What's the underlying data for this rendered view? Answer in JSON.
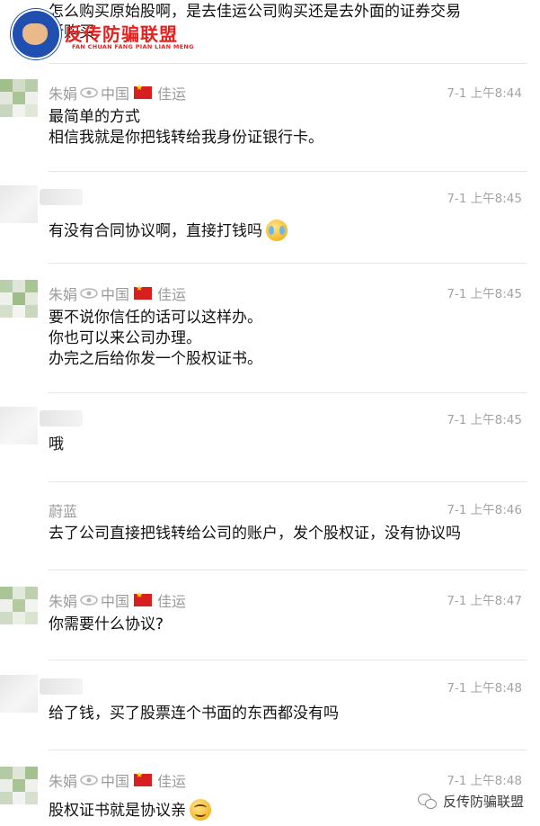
{
  "watermark_top": {
    "cn": "反传防骗联盟",
    "en": "FAN CHUAN FANG PIAN LIAN MENG"
  },
  "watermark_bottom": {
    "icon": "wechat-icon",
    "label": "反传防骗联盟"
  },
  "messages": [
    {
      "kind": "partial",
      "text": "怎么购买原始股啊，是去佳运公司购买还是去外面的证券交易\n所购买"
    },
    {
      "kind": "agent",
      "name": "朱娟",
      "region": "中国",
      "company": "佳运",
      "time": "7-1 上午8:44",
      "text": "最简单的方式\n相信我就是你把钱转给我身份证银行卡。"
    },
    {
      "kind": "user",
      "time": "7-1 上午8:45",
      "text": "有没有合同协议啊，直接打钱吗",
      "emoji": "crying-face"
    },
    {
      "kind": "agent",
      "name": "朱娟",
      "region": "中国",
      "company": "佳运",
      "time": "7-1 上午8:45",
      "text": "要不说你信任的话可以这样办。\n你也可以来公司办理。\n办完之后给你发一个股权证书。"
    },
    {
      "kind": "user",
      "time": "7-1 上午8:45",
      "text": "哦"
    },
    {
      "kind": "other",
      "name": "蔚蓝",
      "time": "7-1 上午8:46",
      "text": "去了公司直接把钱转给公司的账户，发个股权证，没有协议吗"
    },
    {
      "kind": "agent",
      "name": "朱娟",
      "region": "中国",
      "company": "佳运",
      "time": "7-1 上午8:47",
      "text": "你需要什么协议?"
    },
    {
      "kind": "user",
      "time": "7-1 上午8:48",
      "text": "给了钱，买了股票连个书面的东西都没有吗"
    },
    {
      "kind": "agent",
      "name": "朱娟",
      "region": "中国",
      "company": "佳运",
      "time": "7-1 上午8:48",
      "text": "股权证书就是协议亲",
      "emoji": "smiling-face"
    }
  ],
  "colors": {
    "name": "#9a9a9a",
    "time": "#a3a3a3",
    "flag": "#d71f1f",
    "watermark": "#e8201e"
  }
}
